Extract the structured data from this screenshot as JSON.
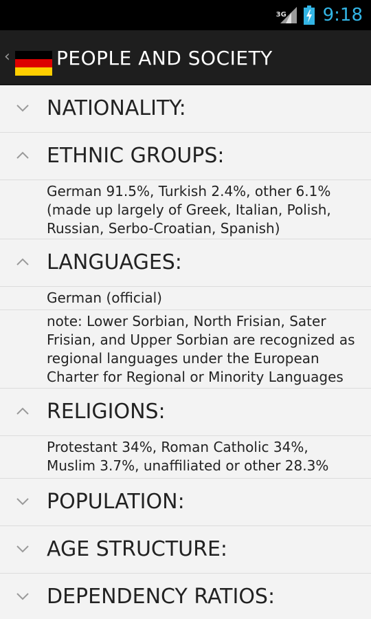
{
  "status_bar": {
    "network": "3G",
    "time": "9:18",
    "icons": [
      "signal-icon",
      "battery-charging-icon"
    ],
    "time_color": "#33b5e5"
  },
  "action_bar": {
    "title": "PEOPLE AND SOCIETY",
    "back_icon": "chevron-left-icon",
    "flag": {
      "name": "germany-flag",
      "colors": [
        "#000000",
        "#dd0000",
        "#ffce00"
      ]
    }
  },
  "sections": {
    "nationality": {
      "title": "NATIONALITY:",
      "expanded": false
    },
    "ethnic_groups": {
      "title": "ETHNIC GROUPS:",
      "expanded": true,
      "details": [
        "German 91.5%, Turkish 2.4%, other 6.1%\n(made up largely of Greek, Italian, Polish,\nRussian, Serbo-Croatian, Spanish)"
      ]
    },
    "languages": {
      "title": "LANGUAGES:",
      "expanded": true,
      "details": [
        "German (official)",
        "note: Lower Sorbian, North Frisian, Sater\nFrisian, and Upper Sorbian are recognized as\nregional languages under the European\nCharter for Regional or Minority Languages"
      ]
    },
    "religions": {
      "title": "RELIGIONS:",
      "expanded": true,
      "details": [
        "Protestant 34%, Roman Catholic 34%,\nMuslim 3.7%, unaffiliated or other 28.3%"
      ]
    },
    "population": {
      "title": "POPULATION:",
      "expanded": false
    },
    "age_structure": {
      "title": "AGE STRUCTURE:",
      "expanded": false
    },
    "dependency_ratios": {
      "title": "DEPENDENCY RATIOS:",
      "expanded": false
    }
  }
}
